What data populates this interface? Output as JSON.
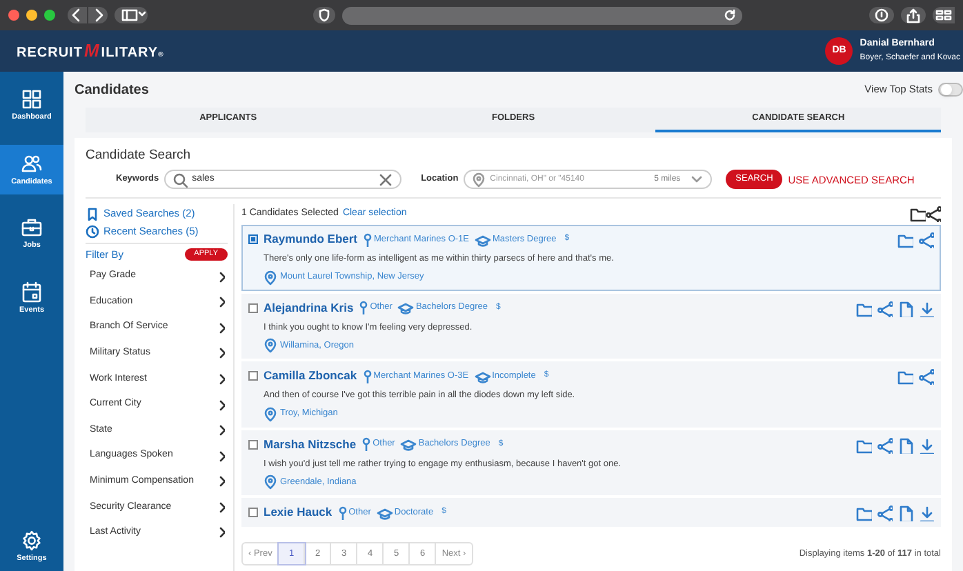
{
  "header": {
    "logo": [
      "RECRUIT",
      "M",
      "ILITARY",
      "®"
    ],
    "user": {
      "initials": "DB",
      "name": "Danial Bernhard",
      "company": "Boyer, Schaefer and Kovac"
    }
  },
  "sidebar": {
    "items": [
      {
        "label": "Dashboard",
        "kind": "dashboard",
        "selected": false
      },
      {
        "label": "Candidates",
        "kind": "candidates",
        "selected": true
      },
      {
        "label": "Jobs",
        "kind": "jobs",
        "selected": false
      },
      {
        "label": "Events",
        "kind": "events",
        "selected": false
      }
    ],
    "bottom": {
      "label": "Settings",
      "kind": "settings",
      "selected": false
    }
  },
  "page": {
    "title": "Candidates",
    "top_stats": {
      "label": "View Top Stats",
      "on": false
    }
  },
  "tabs": [
    {
      "label": "APPLICANTS",
      "selected": false
    },
    {
      "label": "FOLDERS",
      "selected": false
    },
    {
      "label": "CANDIDATE SEARCH",
      "selected": true
    }
  ],
  "search": {
    "title": "Candidate Search",
    "keywords_label": "Keywords",
    "keywords_value": "sales",
    "location_label": "Location",
    "location_placeholder": "Cincinnati, OH\" or \"45140",
    "radius": "5 miles",
    "search_button": "SEARCH",
    "advanced_link": "USE ADVANCED SEARCH"
  },
  "filters": {
    "saved": "Saved Searches (2)",
    "recent": "Recent Searches (5)",
    "filter_by": "Filter By",
    "apply": "APPLY",
    "items": [
      "Pay Grade",
      "Education",
      "Branch Of Service",
      "Military Status",
      "Work Interest",
      "Current City",
      "State",
      "Languages Spoken",
      "Minimum Compensation",
      "Security Clearance",
      "Last Activity"
    ]
  },
  "results": {
    "selection": "1 Candidates Selected",
    "clear": "Clear selection",
    "candidates": [
      {
        "name": "Raymundo Ebert",
        "branch": "Merchant Marines O-1E",
        "education": "Masters Degree",
        "pay": "$",
        "quote": "There's only one life-form as intelligent as me within thirty parsecs of here and that's me.",
        "location": "Mount Laurel Township, New Jersey",
        "checked": true,
        "has_documents": false
      },
      {
        "name": "Alejandrina Kris",
        "branch": "Other",
        "education": "Bachelors Degree",
        "pay": "$",
        "quote": "I think you ought to know I'm feeling very depressed.",
        "location": "Willamina, Oregon",
        "checked": false,
        "has_documents": true
      },
      {
        "name": "Camilla Zboncak",
        "branch": "Merchant Marines O-3E",
        "education": "Incomplete",
        "pay": "$",
        "quote": "And then of course I've got this terrible pain in all the diodes down my left side.",
        "location": "Troy, Michigan",
        "checked": false,
        "has_documents": false
      },
      {
        "name": "Marsha Nitzsche",
        "branch": "Other",
        "education": "Bachelors Degree",
        "pay": "$",
        "quote": "I wish you'd just tell me rather trying to engage my enthusiasm, because I haven't got one.",
        "location": "Greendale, Indiana",
        "checked": false,
        "has_documents": true
      },
      {
        "name": "Lexie Hauck",
        "branch": "Other",
        "education": "Doctorate",
        "pay": "$",
        "checked": false,
        "has_documents": true
      }
    ]
  },
  "pagination": {
    "prev": "‹ Prev",
    "pages": [
      {
        "label": "1",
        "selected": true
      },
      {
        "label": "2",
        "selected": false
      },
      {
        "label": "3",
        "selected": false
      },
      {
        "label": "4",
        "selected": false
      },
      {
        "label": "5",
        "selected": false
      },
      {
        "label": "6",
        "selected": false
      }
    ],
    "next": "Next ›"
  },
  "summary": "Displaying items **1-20** of **117** in total"
}
